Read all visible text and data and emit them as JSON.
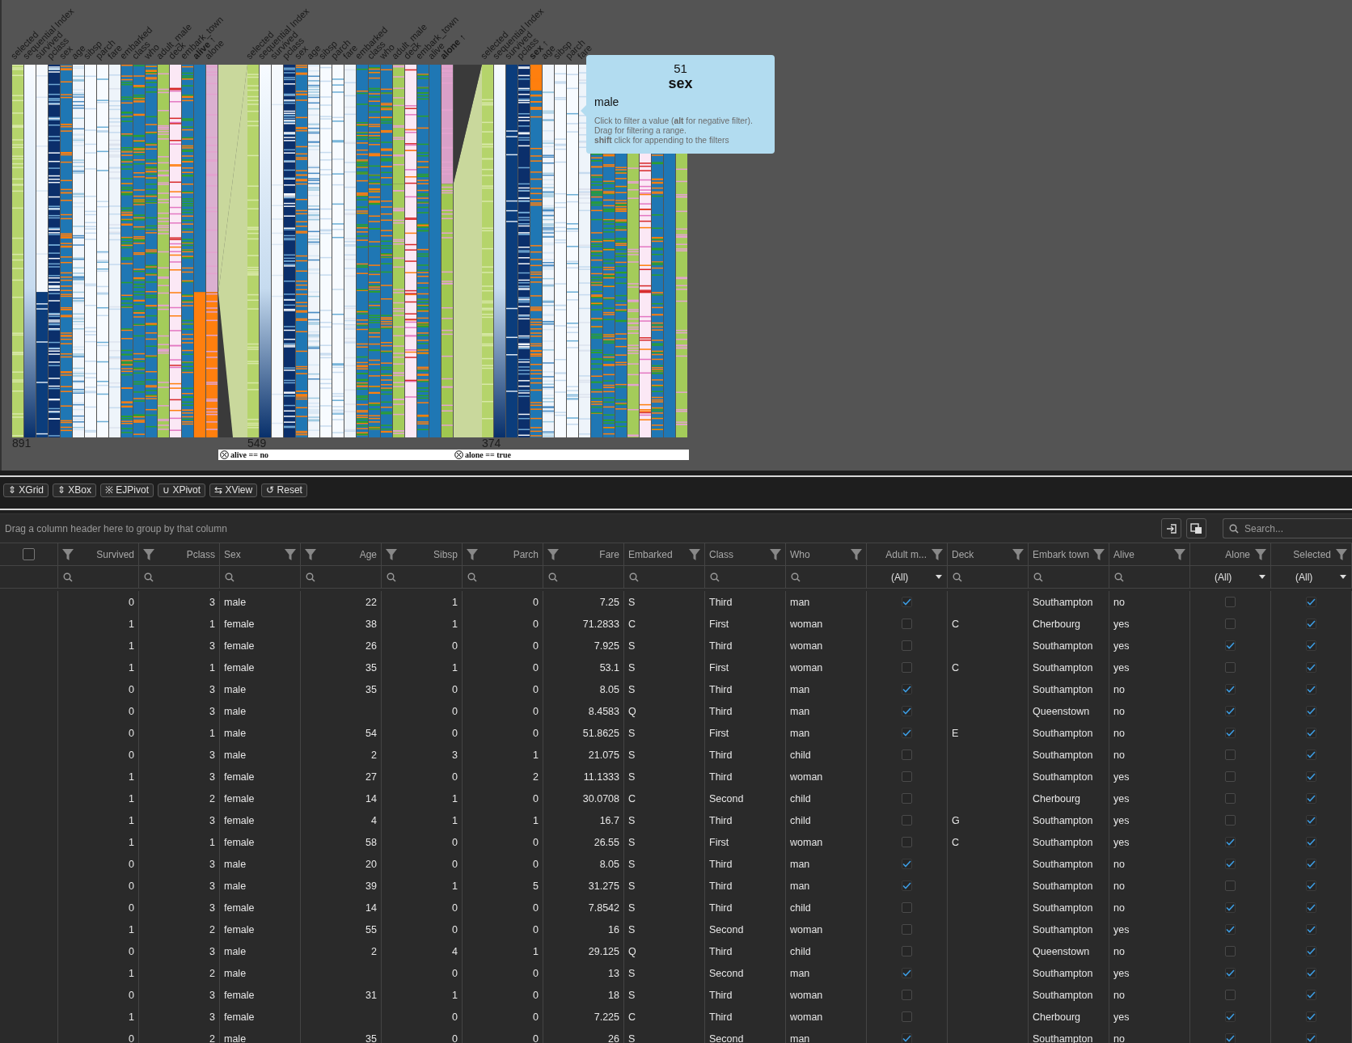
{
  "visualization": {
    "groups": [
      {
        "count": "891",
        "labels": [
          {
            "text": "selected",
            "sorted": false
          },
          {
            "text": "sequential Index",
            "sorted": false
          },
          {
            "text": "survived",
            "sorted": false
          },
          {
            "text": "pclass",
            "sorted": false
          },
          {
            "text": "sex",
            "sorted": false
          },
          {
            "text": "age",
            "sorted": false
          },
          {
            "text": "sibsp",
            "sorted": false
          },
          {
            "text": "parch",
            "sorted": false
          },
          {
            "text": "fare",
            "sorted": false
          },
          {
            "text": "embarked",
            "sorted": false
          },
          {
            "text": "class",
            "sorted": false
          },
          {
            "text": "who",
            "sorted": false
          },
          {
            "text": "adult_male",
            "sorted": false
          },
          {
            "text": "deck",
            "sorted": false
          },
          {
            "text": "embark_town",
            "sorted": false
          },
          {
            "text": "alive ↑",
            "sorted": true
          },
          {
            "text": "alone",
            "sorted": false
          }
        ]
      },
      {
        "count": "549",
        "filter": "alive == no",
        "labels": [
          {
            "text": "selected",
            "sorted": false
          },
          {
            "text": "sequential Index",
            "sorted": false
          },
          {
            "text": "survived",
            "sorted": false
          },
          {
            "text": "pclass",
            "sorted": false
          },
          {
            "text": "sex",
            "sorted": false
          },
          {
            "text": "age",
            "sorted": false
          },
          {
            "text": "sibsp",
            "sorted": false
          },
          {
            "text": "parch",
            "sorted": false
          },
          {
            "text": "fare",
            "sorted": false
          },
          {
            "text": "embarked",
            "sorted": false
          },
          {
            "text": "class",
            "sorted": false
          },
          {
            "text": "who",
            "sorted": false
          },
          {
            "text": "adult_male",
            "sorted": false
          },
          {
            "text": "deck",
            "sorted": false
          },
          {
            "text": "embark_town",
            "sorted": false
          },
          {
            "text": "alive",
            "sorted": false
          },
          {
            "text": "alone ↑",
            "sorted": true
          }
        ]
      },
      {
        "count": "374",
        "filter": "alone == true",
        "labels": [
          {
            "text": "selected",
            "sorted": false
          },
          {
            "text": "sequential Index",
            "sorted": false
          },
          {
            "text": "survived",
            "sorted": false
          },
          {
            "text": "pclass",
            "sorted": false
          },
          {
            "text": "sex ↑",
            "sorted": true
          },
          {
            "text": "age",
            "sorted": false
          },
          {
            "text": "sibsp",
            "sorted": false
          },
          {
            "text": "parch",
            "sorted": false
          },
          {
            "text": "fare",
            "sorted": false
          }
        ]
      }
    ],
    "tooltip": {
      "count": "51",
      "title": "sex",
      "value": "male",
      "hints": [
        "Click to filter a value (**alt** for negative filter).",
        "Drag for filtering a range.",
        "**shift** click for appending to the filters"
      ]
    }
  },
  "toolbar": {
    "buttons": [
      {
        "icon": "⇕",
        "label": "XGrid"
      },
      {
        "icon": "⇕",
        "label": "XBox"
      },
      {
        "icon": "※",
        "label": "EJPivot"
      },
      {
        "icon": "∪",
        "label": "XPivot"
      },
      {
        "icon": "⇆",
        "label": "XView"
      },
      {
        "icon": "↺",
        "label": "Reset"
      }
    ]
  },
  "grid": {
    "group_hint": "Drag a column header here to group by that column",
    "search": {
      "placeholder": "Search..."
    },
    "select_all": false,
    "columns": [
      {
        "label": "Survived",
        "kind": "number"
      },
      {
        "label": "Pclass",
        "kind": "number"
      },
      {
        "label": "Sex",
        "kind": "text"
      },
      {
        "label": "Age",
        "kind": "number"
      },
      {
        "label": "Sibsp",
        "kind": "number"
      },
      {
        "label": "Parch",
        "kind": "number"
      },
      {
        "label": "Fare",
        "kind": "number"
      },
      {
        "label": "Embarked",
        "kind": "text"
      },
      {
        "label": "Class",
        "kind": "text"
      },
      {
        "label": "Who",
        "kind": "text"
      },
      {
        "label": "Adult m...",
        "kind": "check",
        "filter_value": "(All)"
      },
      {
        "label": "Deck",
        "kind": "text"
      },
      {
        "label": "Embark town",
        "kind": "text"
      },
      {
        "label": "Alive",
        "kind": "text"
      },
      {
        "label": "Alone",
        "kind": "check",
        "filter_value": "(All)"
      },
      {
        "label": "Selected",
        "kind": "check",
        "filter_value": "(All)"
      }
    ],
    "rows": [
      [
        "0",
        "3",
        "male",
        "22",
        "1",
        "0",
        "7.25",
        "S",
        "Third",
        "man",
        true,
        null,
        "Southampton",
        "no",
        false,
        true
      ],
      [
        "1",
        "1",
        "female",
        "38",
        "1",
        "0",
        "71.2833",
        "C",
        "First",
        "woman",
        false,
        "C",
        "Cherbourg",
        "yes",
        false,
        true
      ],
      [
        "1",
        "3",
        "female",
        "26",
        "0",
        "0",
        "7.925",
        "S",
        "Third",
        "woman",
        false,
        null,
        "Southampton",
        "yes",
        true,
        true
      ],
      [
        "1",
        "1",
        "female",
        "35",
        "1",
        "0",
        "53.1",
        "S",
        "First",
        "woman",
        false,
        "C",
        "Southampton",
        "yes",
        false,
        true
      ],
      [
        "0",
        "3",
        "male",
        "35",
        "0",
        "0",
        "8.05",
        "S",
        "Third",
        "man",
        true,
        null,
        "Southampton",
        "no",
        true,
        true
      ],
      [
        "0",
        "3",
        "male",
        null,
        "0",
        "0",
        "8.4583",
        "Q",
        "Third",
        "man",
        true,
        null,
        "Queenstown",
        "no",
        true,
        true
      ],
      [
        "0",
        "1",
        "male",
        "54",
        "0",
        "0",
        "51.8625",
        "S",
        "First",
        "man",
        true,
        "E",
        "Southampton",
        "no",
        true,
        true
      ],
      [
        "0",
        "3",
        "male",
        "2",
        "3",
        "1",
        "21.075",
        "S",
        "Third",
        "child",
        false,
        null,
        "Southampton",
        "no",
        false,
        true
      ],
      [
        "1",
        "3",
        "female",
        "27",
        "0",
        "2",
        "11.1333",
        "S",
        "Third",
        "woman",
        false,
        null,
        "Southampton",
        "yes",
        false,
        true
      ],
      [
        "1",
        "2",
        "female",
        "14",
        "1",
        "0",
        "30.0708",
        "C",
        "Second",
        "child",
        false,
        null,
        "Cherbourg",
        "yes",
        false,
        true
      ],
      [
        "1",
        "3",
        "female",
        "4",
        "1",
        "1",
        "16.7",
        "S",
        "Third",
        "child",
        false,
        "G",
        "Southampton",
        "yes",
        false,
        true
      ],
      [
        "1",
        "1",
        "female",
        "58",
        "0",
        "0",
        "26.55",
        "S",
        "First",
        "woman",
        false,
        "C",
        "Southampton",
        "yes",
        true,
        true
      ],
      [
        "0",
        "3",
        "male",
        "20",
        "0",
        "0",
        "8.05",
        "S",
        "Third",
        "man",
        true,
        null,
        "Southampton",
        "no",
        true,
        true
      ],
      [
        "0",
        "3",
        "male",
        "39",
        "1",
        "5",
        "31.275",
        "S",
        "Third",
        "man",
        true,
        null,
        "Southampton",
        "no",
        false,
        true
      ],
      [
        "0",
        "3",
        "female",
        "14",
        "0",
        "0",
        "7.8542",
        "S",
        "Third",
        "child",
        false,
        null,
        "Southampton",
        "no",
        true,
        true
      ],
      [
        "1",
        "2",
        "female",
        "55",
        "0",
        "0",
        "16",
        "S",
        "Second",
        "woman",
        false,
        null,
        "Southampton",
        "yes",
        true,
        true
      ],
      [
        "0",
        "3",
        "male",
        "2",
        "4",
        "1",
        "29.125",
        "Q",
        "Third",
        "child",
        false,
        null,
        "Queenstown",
        "no",
        false,
        true
      ],
      [
        "1",
        "2",
        "male",
        null,
        "0",
        "0",
        "13",
        "S",
        "Second",
        "man",
        true,
        null,
        "Southampton",
        "yes",
        true,
        true
      ],
      [
        "0",
        "3",
        "female",
        "31",
        "1",
        "0",
        "18",
        "S",
        "Third",
        "woman",
        false,
        null,
        "Southampton",
        "no",
        false,
        true
      ],
      [
        "1",
        "3",
        "female",
        null,
        "0",
        "0",
        "7.225",
        "C",
        "Third",
        "woman",
        false,
        null,
        "Cherbourg",
        "yes",
        true,
        true
      ],
      [
        "0",
        "2",
        "male",
        "35",
        "0",
        "0",
        "26",
        "S",
        "Second",
        "man",
        true,
        null,
        "Southampton",
        "no",
        true,
        true
      ]
    ]
  }
}
